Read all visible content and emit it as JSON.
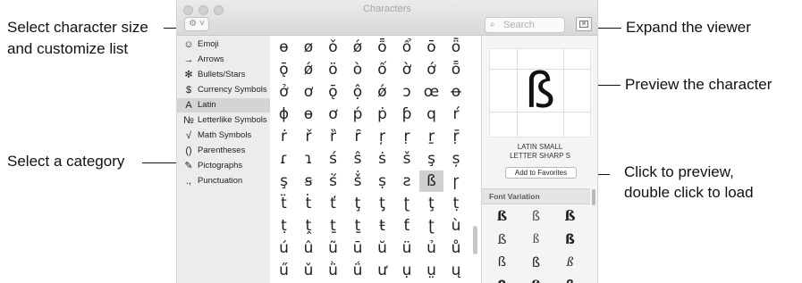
{
  "callouts": {
    "size": "Select character size",
    "customize": "and customize list",
    "category": "Select a category",
    "expand": "Expand the viewer",
    "preview": "Preview the character",
    "click1": "Click to preview,",
    "click2": "double click to load"
  },
  "window": {
    "title": "Characters"
  },
  "toolbar": {
    "gear": "⚙ ˅",
    "search_placeholder": "Search",
    "expand_icon": "⌘"
  },
  "sidebar": {
    "items": [
      {
        "icon": "☺",
        "label": "Emoji"
      },
      {
        "icon": "→",
        "label": "Arrows"
      },
      {
        "icon": "✻",
        "label": "Bullets/Stars"
      },
      {
        "icon": "$",
        "label": "Currency Symbols"
      },
      {
        "icon": "A",
        "label": "Latin"
      },
      {
        "icon": "№",
        "label": "Letterlike Symbols"
      },
      {
        "icon": "√",
        "label": "Math Symbols"
      },
      {
        "icon": "()",
        "label": "Parentheses"
      },
      {
        "icon": "✎",
        "label": "Pictographs"
      },
      {
        "icon": ".,",
        "label": "Punctuation"
      }
    ],
    "selected": "Latin"
  },
  "grid": {
    "rows": [
      [
        "ɵ",
        "ø",
        "ǒ",
        "ǿ",
        "ȭ",
        "ổ",
        "ō",
        "ȫ"
      ],
      [
        "ǭ",
        "ǿ",
        "ö",
        "ò",
        "ố",
        "ờ",
        "ớ",
        "ȭ"
      ],
      [
        "ở",
        "ơ",
        "ǭ",
        "ộ",
        "ǿ",
        "ɔ",
        "œ",
        "ꝋ"
      ],
      [
        "ɸ",
        "ɵ",
        "ơ",
        "ṕ",
        "ṗ",
        "ƥ",
        "q",
        "ŕ"
      ],
      [
        "ṙ",
        "ř",
        "ȑ",
        "ȓ",
        "ŗ",
        "ṛ",
        "ṟ",
        "ṝ"
      ],
      [
        "ɾ",
        "ɿ",
        "ś",
        "ŝ",
        "ṡ",
        "š",
        "ş",
        "ș"
      ],
      [
        "ş",
        "ꞩ",
        "ṥ",
        "ṧ",
        "ṣ",
        "ƨ",
        "ß",
        "ꞅ"
      ],
      [
        "ẗ",
        "ṫ",
        "ť",
        "ţ",
        "ƫ",
        "ʈ",
        "ţ",
        "ṭ"
      ],
      [
        "ṭ",
        "ṱ",
        "ṯ",
        "ṯ",
        "ŧ",
        "ƭ",
        "ʈ",
        "ù"
      ],
      [
        "ú",
        "û",
        "ũ",
        "ū",
        "ŭ",
        "ü",
        "ủ",
        "ů"
      ],
      [
        "ű",
        "ǔ",
        "ǜ",
        "ǘ",
        "ư",
        "ụ",
        "ṳ",
        "ų"
      ]
    ]
  },
  "preview": {
    "char": "ß",
    "name_line1": "LATIN SMALL",
    "name_line2": "LETTER SHARP S",
    "favorites_label": "Add to Favorites",
    "font_variation_label": "Font Variation",
    "variations": [
      [
        "ß",
        "ß",
        "ß"
      ],
      [
        "ß",
        "ß",
        "ß"
      ],
      [
        "ß",
        "ß",
        "ß"
      ],
      [
        "ß",
        "ß",
        "ß"
      ]
    ]
  }
}
